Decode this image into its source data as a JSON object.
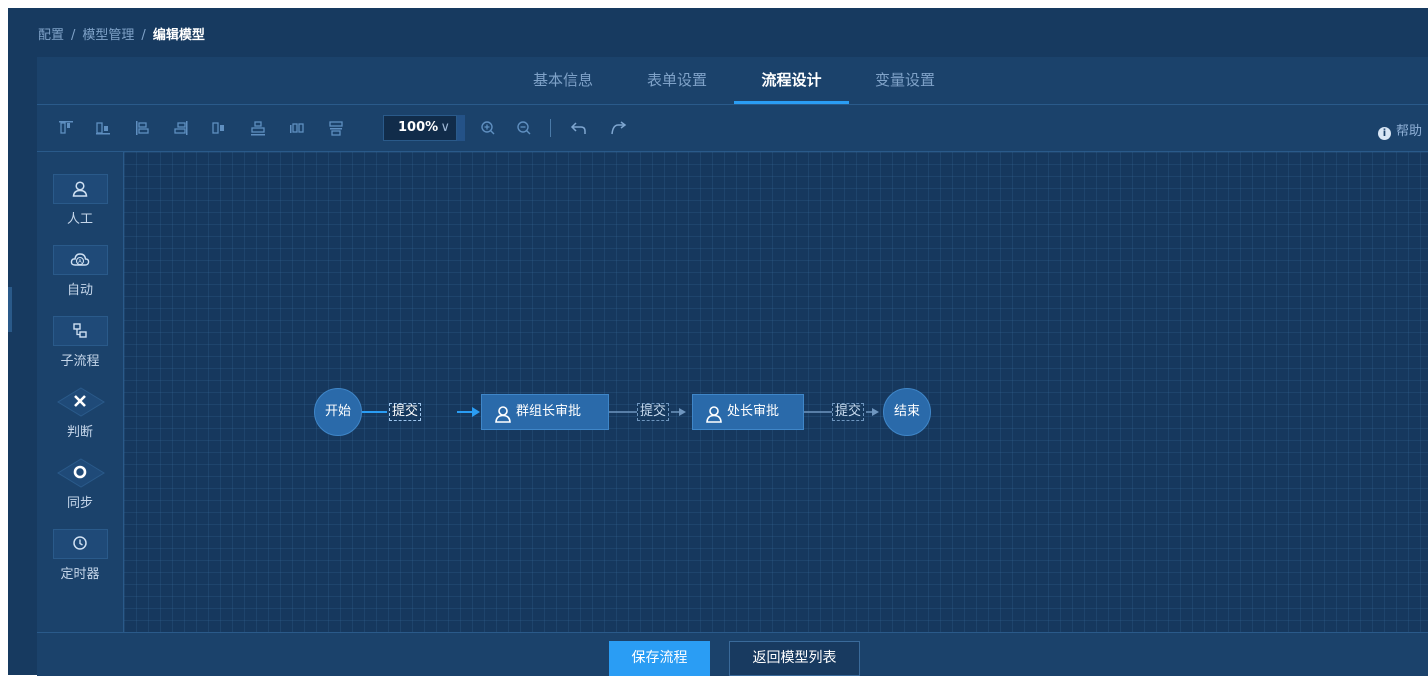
{
  "breadcrumb": {
    "items": [
      "配置",
      "模型管理"
    ],
    "separator": "/",
    "current": "编辑模型"
  },
  "tabs": [
    {
      "label": "基本信息",
      "active": false
    },
    {
      "label": "表单设置",
      "active": false
    },
    {
      "label": "流程设计",
      "active": true
    },
    {
      "label": "变量设置",
      "active": false
    }
  ],
  "toolbar": {
    "align_tools": [
      "align-top-icon",
      "align-middle-icon",
      "align-left-icon",
      "align-right-icon",
      "align-center-horizontal-icon",
      "align-bottom-icon",
      "distribute-horizontal-icon",
      "distribute-vertical-icon"
    ],
    "zoom": "100%",
    "zoom_chevron": "∨",
    "help_label": "帮助"
  },
  "palette": [
    {
      "label": "人工",
      "icon": "person-icon"
    },
    {
      "label": "自动",
      "icon": "cloud-auto-icon"
    },
    {
      "label": "子流程",
      "icon": "subprocess-icon"
    },
    {
      "label": "判断",
      "icon": "close-diamond-icon"
    },
    {
      "label": "同步",
      "icon": "circle-diamond-icon"
    },
    {
      "label": "定时器",
      "icon": "clock-icon"
    }
  ],
  "flow": {
    "start": "开始",
    "edges": [
      "提交",
      "提交",
      "提交"
    ],
    "tasks": [
      "群组长审批",
      "处长审批"
    ],
    "end": "结束"
  },
  "footer": {
    "save_label": "保存流程",
    "back_label": "返回模型列表"
  },
  "colors": {
    "accent": "#2a9df4",
    "background": "#173a60",
    "node": "#2a6aaa"
  }
}
